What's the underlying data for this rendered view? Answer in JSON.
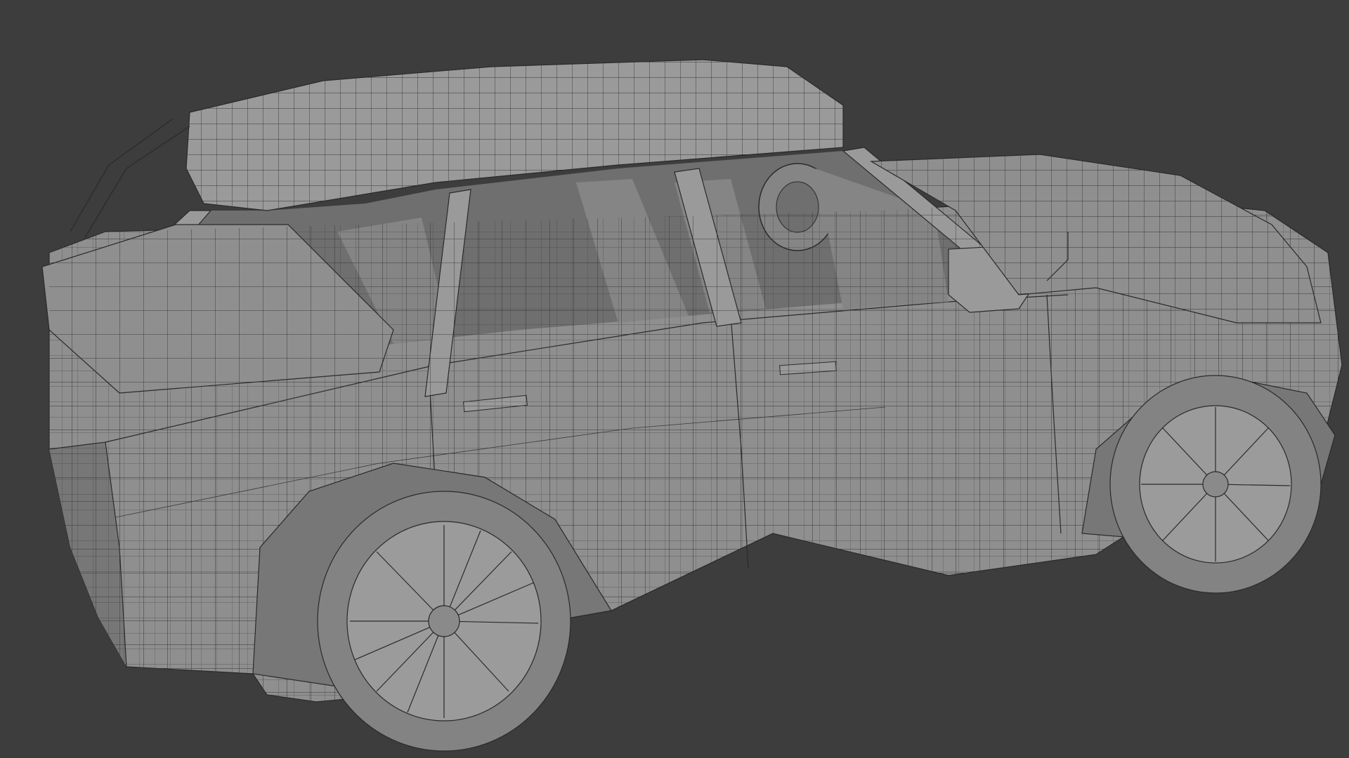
{
  "viewport": {
    "background_color": "#3d3d3d",
    "mesh_color": "#8f8f8f",
    "wire_color": "#2a2a2a",
    "subject": "suv-wireframe-mesh"
  }
}
